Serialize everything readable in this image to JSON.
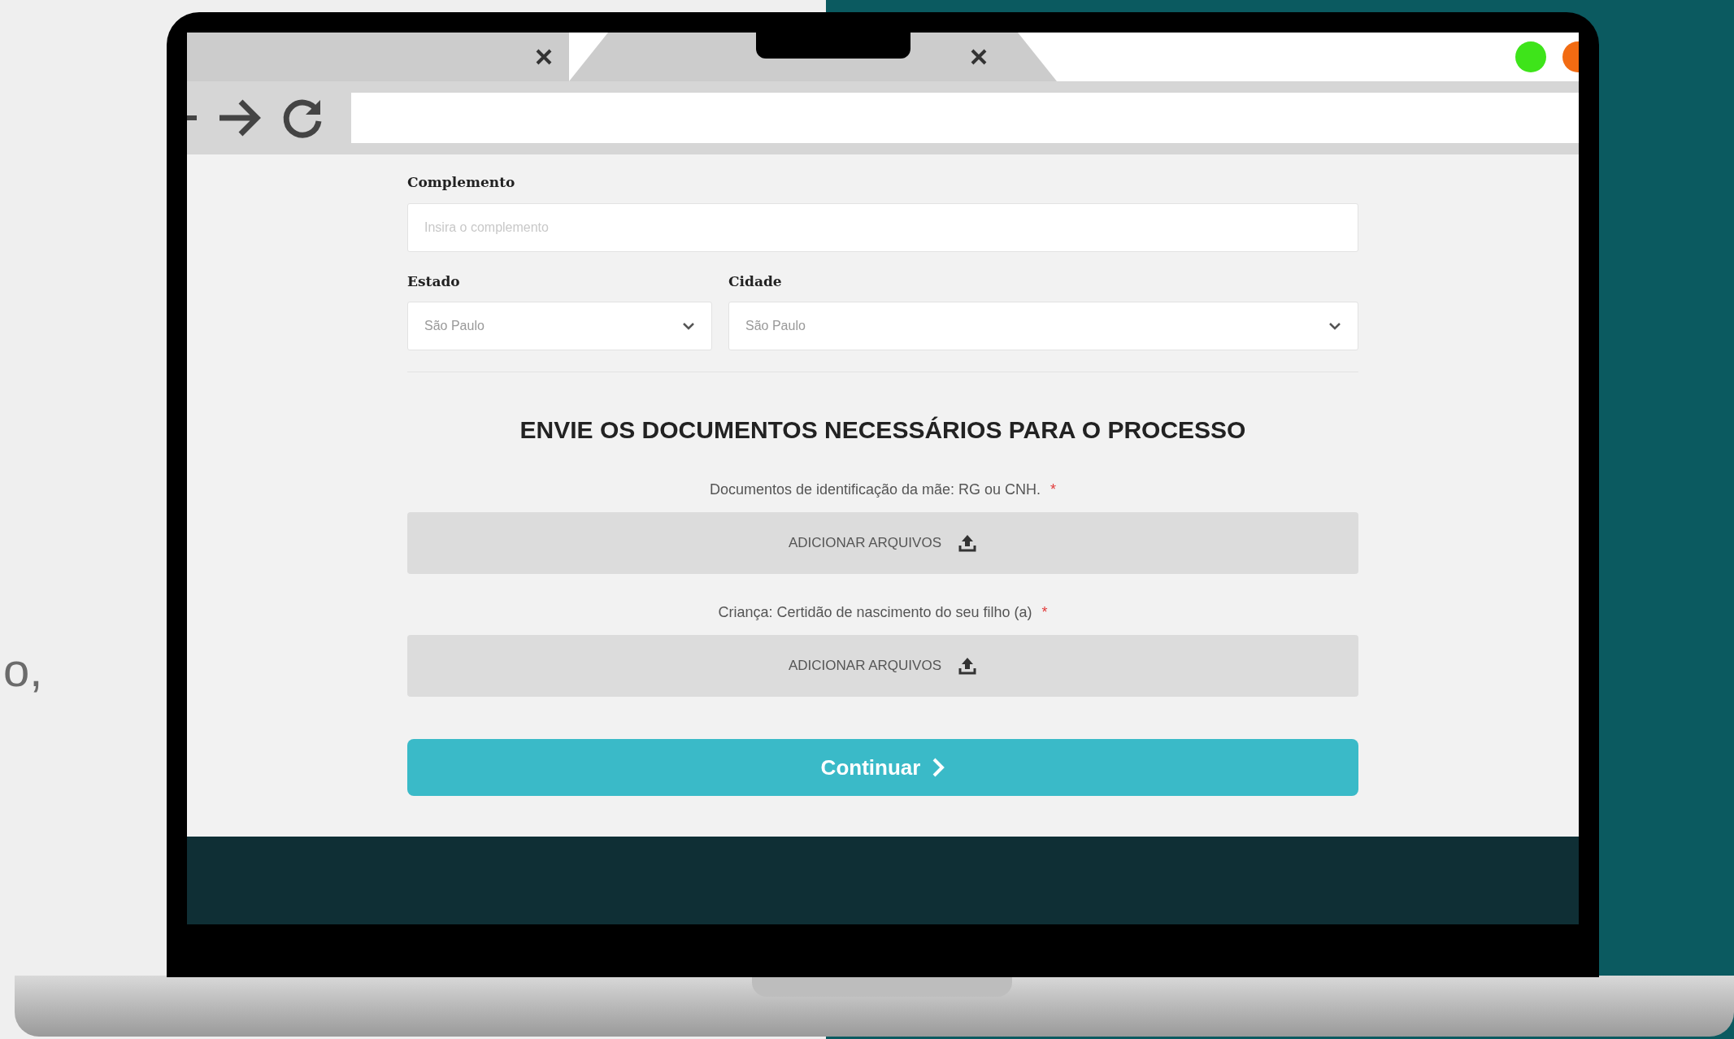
{
  "slide_text": "o,",
  "form": {
    "fields": [
      {
        "kind": "text",
        "label": "Complemento",
        "placeholder": "Insira o complemento"
      },
      {
        "kind": "select",
        "label": "Estado",
        "value": "São Paulo"
      },
      {
        "kind": "select",
        "label": "Cidade",
        "value": "São Paulo"
      }
    ],
    "section_title": "ENVIE OS DOCUMENTOS NECESSÁRIOS PARA O PROCESSO",
    "uploads": [
      {
        "label": "Documentos de identificação da mãe: RG ou CNH.",
        "required_mark": "*",
        "button": "ADICIONAR ARQUIVOS"
      },
      {
        "label": "Criança: Certidão de nascimento do seu filho (a)",
        "required_mark": "*",
        "button": "ADICIONAR ARQUIVOS"
      }
    ],
    "submit": "Continuar"
  }
}
